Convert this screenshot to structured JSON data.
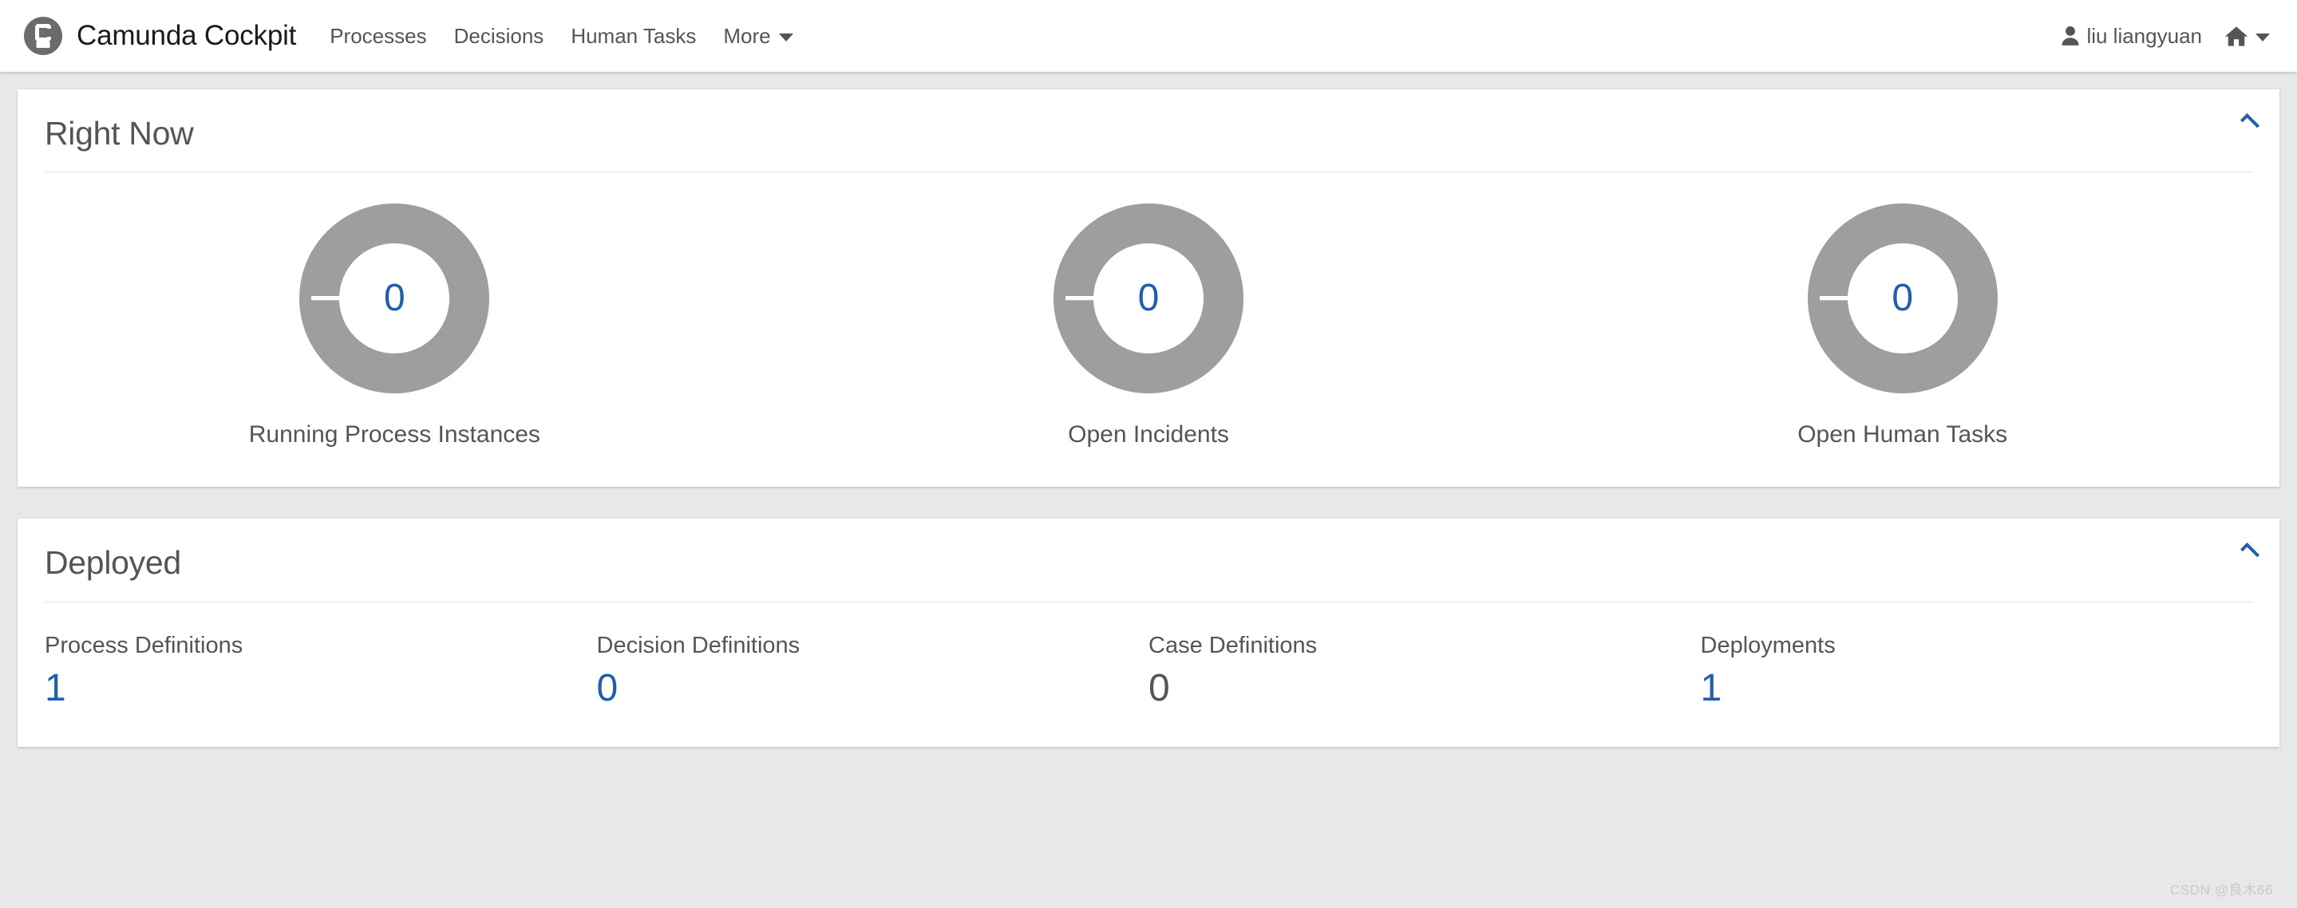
{
  "header": {
    "brand_title": "Camunda Cockpit",
    "logo_icon": "camunda-logo-icon",
    "nav_items": [
      {
        "label": "Processes",
        "name": "nav-processes"
      },
      {
        "label": "Decisions",
        "name": "nav-decisions"
      },
      {
        "label": "Human Tasks",
        "name": "nav-human-tasks"
      },
      {
        "label": "More",
        "name": "nav-more",
        "has_caret": true
      }
    ],
    "user_name": "liu liangyuan",
    "user_icon": "person-icon",
    "home_icon": "home-icon",
    "home_caret_icon": "caret-down-icon"
  },
  "right_now": {
    "title": "Right Now",
    "collapse_icon": "chevron-up-icon",
    "metrics": [
      {
        "label": "Running Process Instances",
        "value": "0"
      },
      {
        "label": "Open Incidents",
        "value": "0"
      },
      {
        "label": "Open Human Tasks",
        "value": "0"
      }
    ]
  },
  "deployed": {
    "title": "Deployed",
    "collapse_icon": "chevron-up-icon",
    "stats": [
      {
        "label": "Process Definitions",
        "value": "1",
        "link": true
      },
      {
        "label": "Decision Definitions",
        "value": "0",
        "link": true
      },
      {
        "label": "Case Definitions",
        "value": "0",
        "link": false
      },
      {
        "label": "Deployments",
        "value": "1",
        "link": true
      }
    ]
  },
  "colors": {
    "accent_blue": "#1f5fab",
    "text_gray": "#555555",
    "donut_gray": "#9e9e9e",
    "page_background": "#e8e8e8",
    "panel_background": "#ffffff"
  },
  "watermark": "CSDN @良木66",
  "chart_data": [
    {
      "type": "pie",
      "title": "Running Process Instances",
      "categories": [
        "Running Process Instances"
      ],
      "values": [
        0
      ],
      "center_label": "0",
      "legend": "none",
      "colors": [
        "#9e9e9e"
      ]
    },
    {
      "type": "pie",
      "title": "Open Incidents",
      "categories": [
        "Open Incidents"
      ],
      "values": [
        0
      ],
      "center_label": "0",
      "legend": "none",
      "colors": [
        "#9e9e9e"
      ]
    },
    {
      "type": "pie",
      "title": "Open Human Tasks",
      "categories": [
        "Open Human Tasks"
      ],
      "values": [
        0
      ],
      "center_label": "0",
      "legend": "none",
      "colors": [
        "#9e9e9e"
      ]
    }
  ]
}
